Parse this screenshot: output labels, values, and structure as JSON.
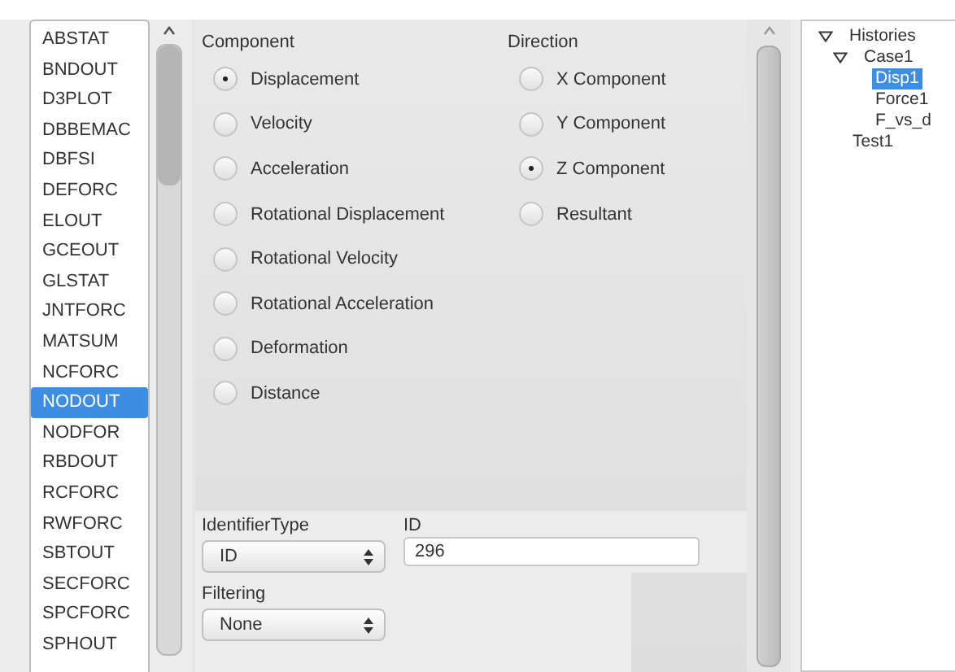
{
  "file_list": {
    "items": [
      {
        "label": "ABSTAT",
        "selected": false
      },
      {
        "label": "BNDOUT",
        "selected": false
      },
      {
        "label": "D3PLOT",
        "selected": false
      },
      {
        "label": "DBBEMAC",
        "selected": false
      },
      {
        "label": "DBFSI",
        "selected": false
      },
      {
        "label": "DEFORC",
        "selected": false
      },
      {
        "label": "ELOUT",
        "selected": false
      },
      {
        "label": "GCEOUT",
        "selected": false
      },
      {
        "label": "GLSTAT",
        "selected": false
      },
      {
        "label": "JNTFORC",
        "selected": false
      },
      {
        "label": "MATSUM",
        "selected": false
      },
      {
        "label": "NCFORC",
        "selected": false
      },
      {
        "label": "NODOUT",
        "selected": true
      },
      {
        "label": "NODFOR",
        "selected": false
      },
      {
        "label": "RBDOUT",
        "selected": false
      },
      {
        "label": "RCFORC",
        "selected": false
      },
      {
        "label": "RWFORC",
        "selected": false
      },
      {
        "label": "SBTOUT",
        "selected": false
      },
      {
        "label": "SECFORC",
        "selected": false
      },
      {
        "label": "SPCFORC",
        "selected": false
      },
      {
        "label": "SPHOUT",
        "selected": false
      }
    ]
  },
  "component": {
    "title": "Component",
    "options": [
      {
        "label": "Displacement",
        "selected": true
      },
      {
        "label": "Velocity",
        "selected": false
      },
      {
        "label": "Acceleration",
        "selected": false
      },
      {
        "label": "Rotational Displacement",
        "selected": false
      },
      {
        "label": "Rotational Velocity",
        "selected": false
      },
      {
        "label": "Rotational Acceleration",
        "selected": false
      },
      {
        "label": "Deformation",
        "selected": false
      },
      {
        "label": "Distance",
        "selected": false
      }
    ]
  },
  "direction": {
    "title": "Direction",
    "options": [
      {
        "label": "X Component",
        "selected": false
      },
      {
        "label": "Y Component",
        "selected": false
      },
      {
        "label": "Z Component",
        "selected": true
      },
      {
        "label": "Resultant",
        "selected": false
      }
    ]
  },
  "identifier": {
    "type_label": "IdentifierType",
    "type_value": "ID",
    "id_label": "ID",
    "id_value": "296"
  },
  "filtering": {
    "label": "Filtering",
    "value": "None"
  },
  "tree": [
    {
      "label": "Histories",
      "selected": false,
      "expanded": true,
      "children": [
        {
          "label": "Case1",
          "selected": false,
          "expanded": true,
          "children": [
            {
              "label": "Disp1",
              "selected": true
            },
            {
              "label": "Force1",
              "selected": false
            },
            {
              "label": "F_vs_d",
              "selected": false
            }
          ]
        },
        {
          "label": "Test1",
          "selected": false
        }
      ]
    }
  ]
}
